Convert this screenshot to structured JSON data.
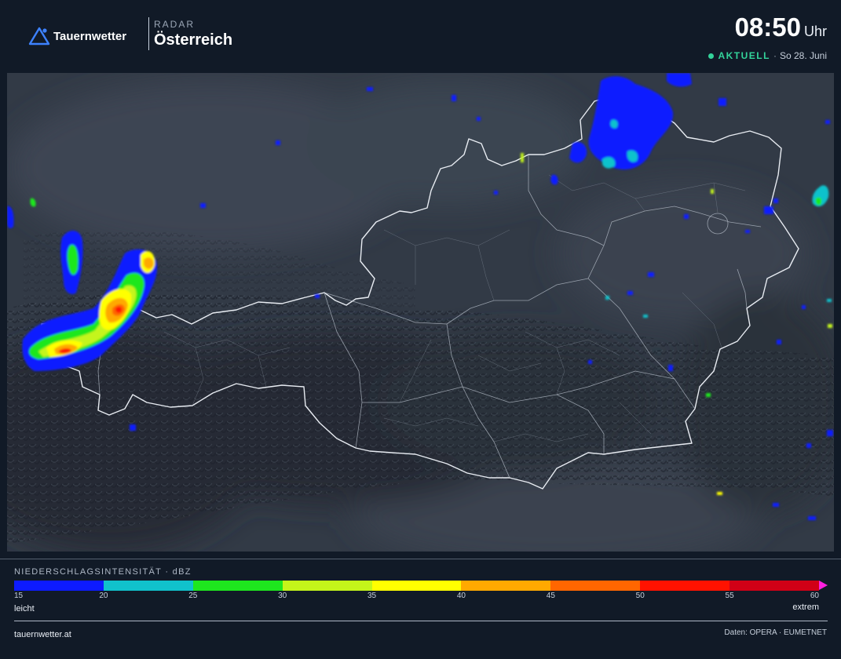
{
  "brand": {
    "name": "Tauernwetter",
    "logo_icon": "mountain-triangle-icon",
    "accent": "#3d82ff"
  },
  "region": {
    "kicker": "RADAR",
    "title": "Österreich"
  },
  "clock": {
    "time": "08:50",
    "unit": "Uhr"
  },
  "status": {
    "label": "AKTUELL",
    "separator": "·",
    "date": "So 28. Juni",
    "color": "#33d39a"
  },
  "map": {
    "region": "Austria",
    "basemap": "dark shaded relief",
    "layer": "precipitation radar (dBZ)",
    "echo_areas": [
      {
        "area": "west (Lake Constance / Vorarlberg)",
        "max_dbz": 55
      },
      {
        "area": "north (Bohemia / Waldviertel border)",
        "max_dbz": 25
      },
      {
        "area": "east (Burgenland / Styria)",
        "max_dbz": 20
      }
    ]
  },
  "legend": {
    "title": "NIEDERSCHLAGSINTENSITÄT · dBZ",
    "ticks": [
      "15",
      "20",
      "25",
      "30",
      "35",
      "40",
      "45",
      "50",
      "55",
      "60"
    ],
    "colors": [
      "#0d1bff",
      "#10c2cc",
      "#1ee71e",
      "#c4f51a",
      "#ffff00",
      "#ffa900",
      "#ff6600",
      "#ff1200",
      "#d10016"
    ],
    "overflow_color": "#ff20e0",
    "min_label": "leicht",
    "max_label": "extrem"
  },
  "footer": {
    "site": "tauernwetter.at",
    "source": "Daten: OPERA · EUMETNET"
  }
}
